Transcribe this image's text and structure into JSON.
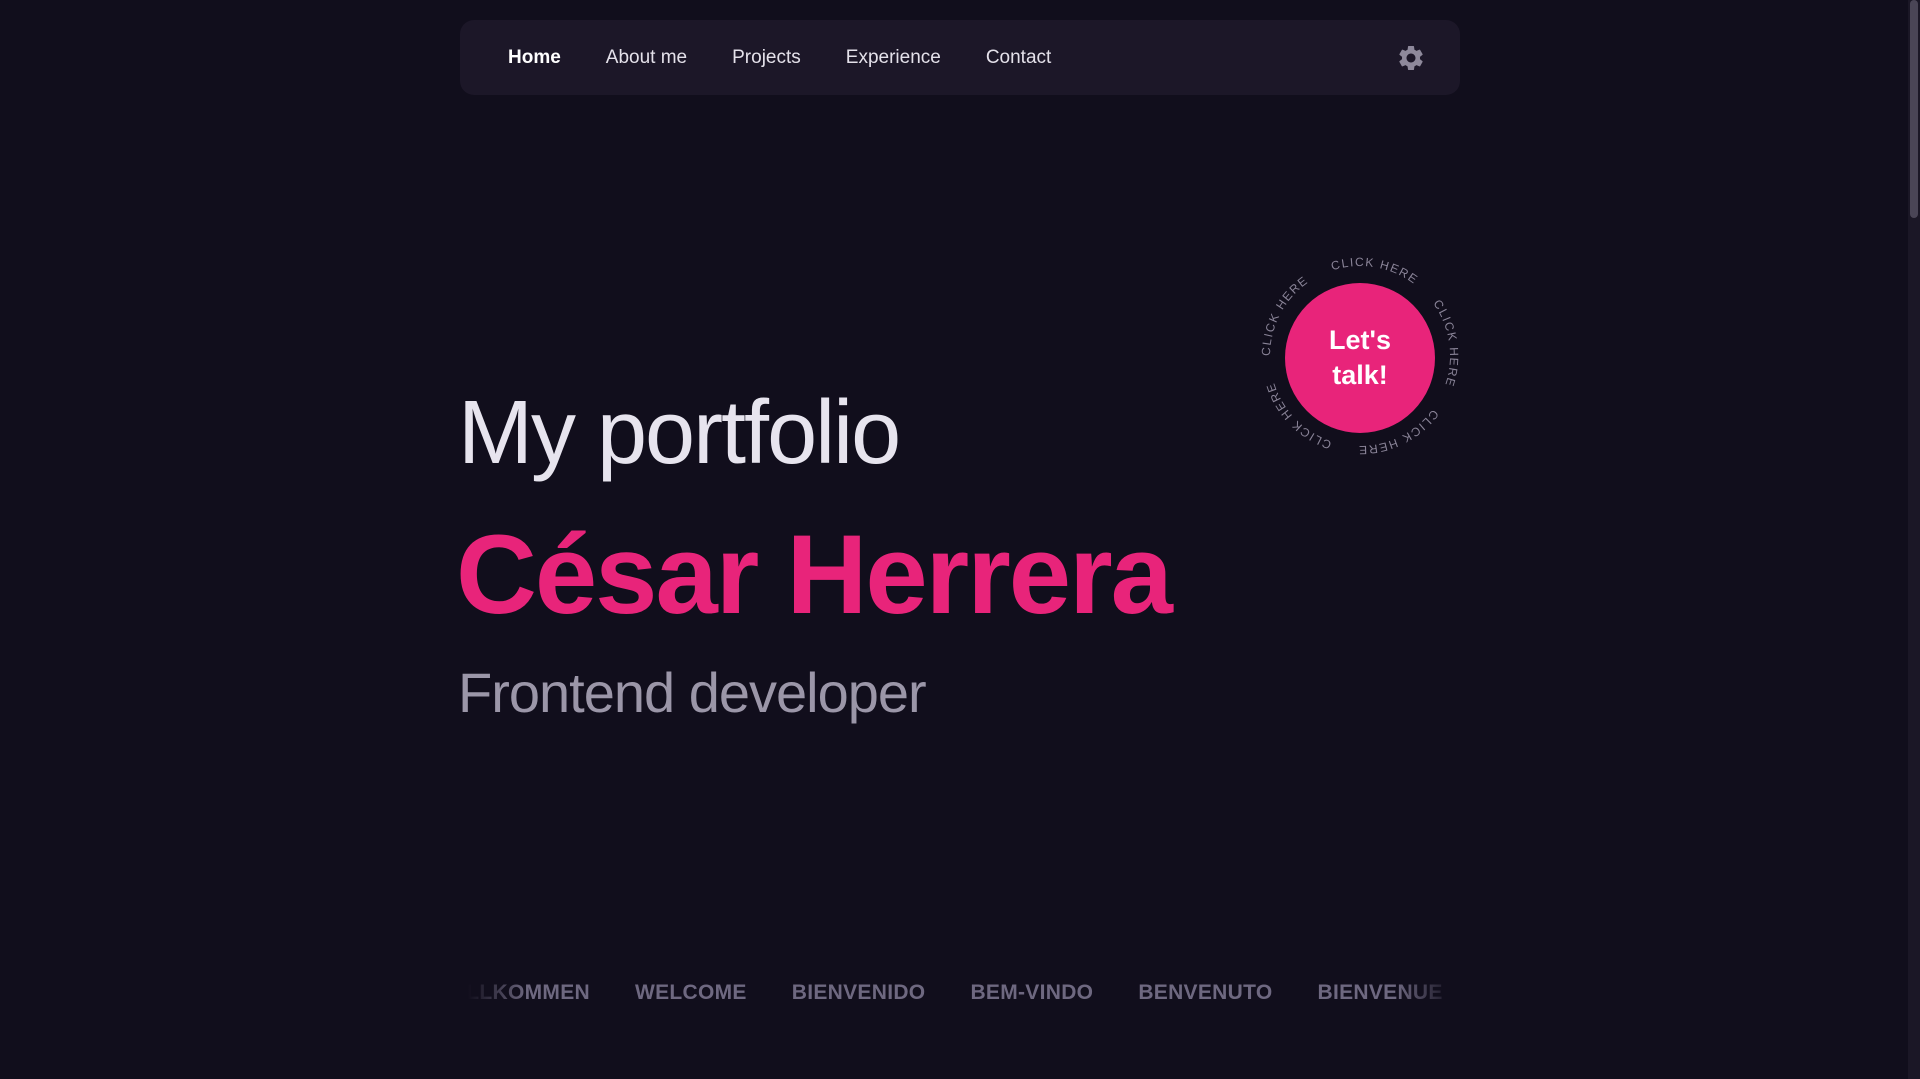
{
  "nav": {
    "items": [
      {
        "label": "Home",
        "active": true
      },
      {
        "label": "About me",
        "active": false
      },
      {
        "label": "Projects",
        "active": false
      },
      {
        "label": "Experience",
        "active": false
      },
      {
        "label": "Contact",
        "active": false
      }
    ],
    "settings_icon": "gear-icon"
  },
  "hero": {
    "title": "My portfolio",
    "name": "César Herrera",
    "role": "Frontend developer"
  },
  "talk_badge": {
    "label": "Let's talk!",
    "ring_text": "CLICK HERE"
  },
  "marquee": {
    "items": [
      "WILLKOMMEN",
      "WELCOME",
      "BIENVENIDO",
      "BEM-VINDO",
      "BENVENUTO",
      "BIENVENUE"
    ]
  },
  "colors": {
    "background": "#110e1c",
    "nav_background": "#1c1728",
    "accent": "#e8247a",
    "title": "#e7e4ee",
    "role": "#9b96a8",
    "marquee": "#6e6880"
  }
}
